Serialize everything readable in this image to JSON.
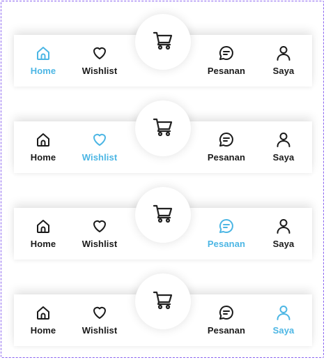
{
  "accent_color": "#4cb6e4",
  "inactive_color": "#1a1a1a",
  "center_button": {
    "icon": "cart-icon"
  },
  "nav_items": [
    {
      "label": "Home",
      "icon": "home-icon"
    },
    {
      "label": "Wishlist",
      "icon": "heart-icon"
    },
    {
      "label": "Pesanan",
      "icon": "chat-icon"
    },
    {
      "label": "Saya",
      "icon": "user-icon"
    }
  ],
  "variants": [
    {
      "active": "Home"
    },
    {
      "active": "Wishlist"
    },
    {
      "active": "Pesanan"
    },
    {
      "active": "Saya"
    }
  ]
}
